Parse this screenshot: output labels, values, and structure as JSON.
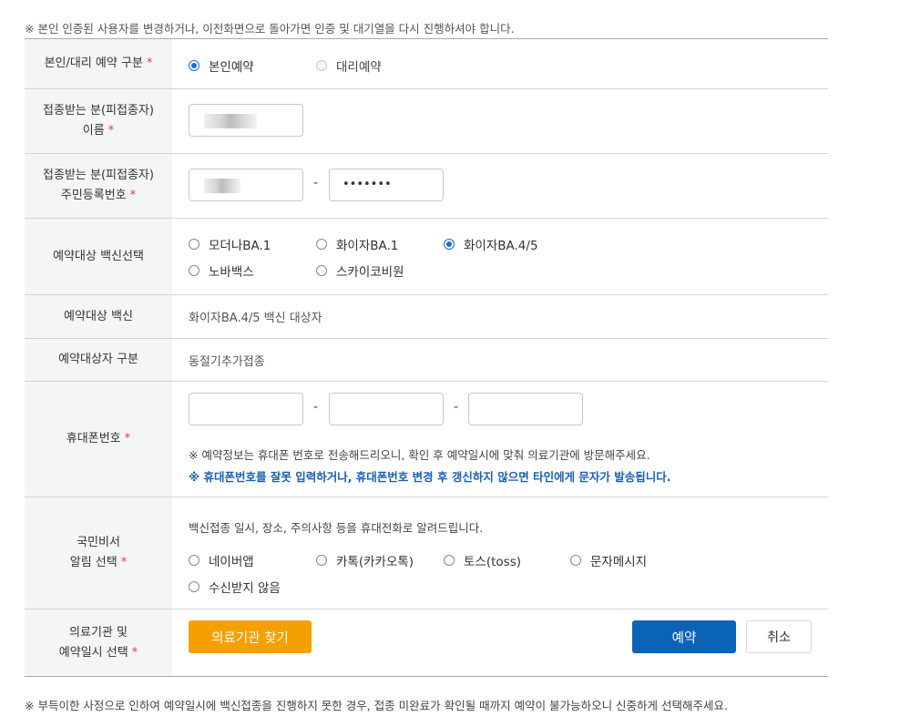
{
  "notice_top": "※ 본인 인증된 사용자를 변경하거나, 이전화면으로 돌아가면 인증 및 대기열을 다시 진행하셔야 합니다.",
  "required_mark": "*",
  "rows": {
    "type": {
      "label": "본인/대리 예약 구분",
      "options": [
        "본인예약",
        "대리예약"
      ],
      "selected": "본인예약"
    },
    "name": {
      "label1": "접종받는 분(피접종자)",
      "label2": "이름"
    },
    "rrn": {
      "label1": "접종받는 분(피접종자)",
      "label2": "주민등록번호",
      "back_value": "•••••••",
      "separator": "-"
    },
    "vaccine": {
      "label": "예약대상 백신선택",
      "options": [
        "모더나BA.1",
        "화이자BA.1",
        "화이자BA.4/5",
        "노바백스",
        "스카이코비원"
      ],
      "selected": "화이자BA.4/5"
    },
    "target": {
      "label": "예약대상 백신",
      "value": "화이자BA.4/5 백신 대상자"
    },
    "category": {
      "label": "예약대상자 구분",
      "value": "동절기추가접종"
    },
    "phone": {
      "label": "휴대폰번호",
      "separator": "-",
      "note": "※ 예약정보는 휴대폰 번호로 전송해드리오니, 확인 후 예약일시에 맞춰 의료기관에 방문해주세요.",
      "warning": "※ 휴대폰번호를 잘못 입력하거나, 휴대폰번호 변경 후 갱신하지 않으면 타인에게 문자가 발송됩니다."
    },
    "alert": {
      "label1": "국민비서",
      "label2": "알림 선택",
      "desc": "백신접종 일시, 장소, 주의사항 등을 휴대전화로 알려드립니다.",
      "options": [
        "네이버앱",
        "카톡(카카오톡)",
        "토스(toss)",
        "문자메시지",
        "수신받지 않음"
      ]
    },
    "clinic": {
      "label1": "의료기관 및",
      "label2": "예약일시 선택",
      "find_button": "의료기관 찾기",
      "reserve_button": "예약",
      "cancel_button": "취소"
    }
  },
  "notice_bottom": "※ 부득이한 사정으로 인하여 예약일시에 백신접종을 진행하지 못한 경우, 접종 미완료가 확인될 때까지 예약이 불가능하오니 신중하게 선택해주세요.",
  "colors": {
    "accent": "#1a6ed8",
    "find_button": "#f5a000",
    "reserve_button": "#0b63b6",
    "required": "#e0403a",
    "warning_text": "#1a5fb4"
  }
}
